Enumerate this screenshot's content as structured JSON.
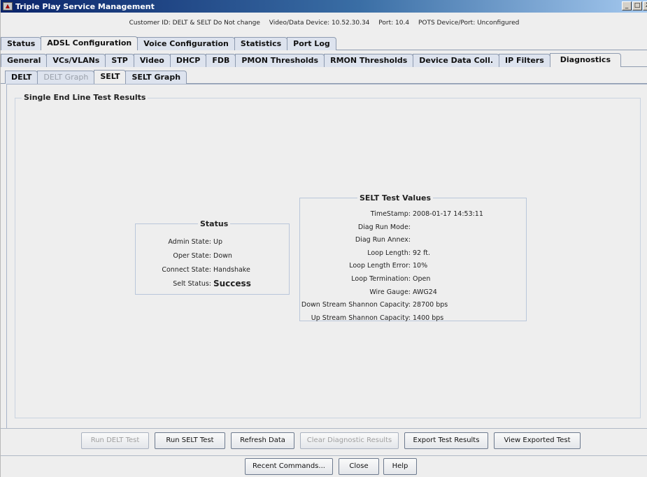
{
  "window": {
    "title": "Triple Play Service Management",
    "buttons": [
      "_",
      "□",
      "X"
    ]
  },
  "info": {
    "customer": "Customer ID: DELT & SELT Do Not change",
    "device": "Video/Data Device: 10.52.30.34",
    "port": "Port: 10.4",
    "pots": "POTS Device/Port: Unconfigured"
  },
  "tabs_main": [
    "Status",
    "ADSL Configuration",
    "Voice Configuration",
    "Statistics",
    "Port Log"
  ],
  "tabs_adsl": [
    "General",
    "VCs/VLANs",
    "STP",
    "Video",
    "DHCP",
    "FDB",
    "PMON Thresholds",
    "RMON Thresholds",
    "Device Data Coll.",
    "IP Filters",
    "Diagnostics"
  ],
  "tabs_diag": [
    "DELT",
    "DELT Graph",
    "SELT",
    "SELT Graph"
  ],
  "results": {
    "title": "Single End Line Test Results"
  },
  "status": {
    "title": "Status",
    "rows": [
      {
        "label": "Admin State:",
        "value": "Up"
      },
      {
        "label": "Oper State:",
        "value": "Down"
      },
      {
        "label": "Connect State:",
        "value": "Handshake"
      },
      {
        "label": "Selt Status:",
        "value": "Success"
      }
    ]
  },
  "selt": {
    "title": "SELT Test Values",
    "rows": [
      {
        "label": "TimeStamp:",
        "value": "2008-01-17 14:53:11"
      },
      {
        "label": "Diag Run Mode:",
        "value": ""
      },
      {
        "label": "Diag Run Annex:",
        "value": ""
      },
      {
        "label": "Loop Length:",
        "value": "92 ft."
      },
      {
        "label": "Loop Length Error:",
        "value": "10%"
      },
      {
        "label": "Loop Termination:",
        "value": "Open"
      },
      {
        "label": "Wire Gauge:",
        "value": "AWG24"
      },
      {
        "label": "Down Stream Shannon Capacity:",
        "value": "28700 bps"
      },
      {
        "label": "Up Stream Shannon Capacity:",
        "value": "1400 bps"
      }
    ]
  },
  "actions": [
    "Run DELT Test",
    "Run SELT Test",
    "Refresh Data",
    "Clear Diagnostic Results",
    "Export Test Results",
    "View Exported Test"
  ],
  "footer": [
    "Recent Commands...",
    "Close",
    "Help"
  ]
}
